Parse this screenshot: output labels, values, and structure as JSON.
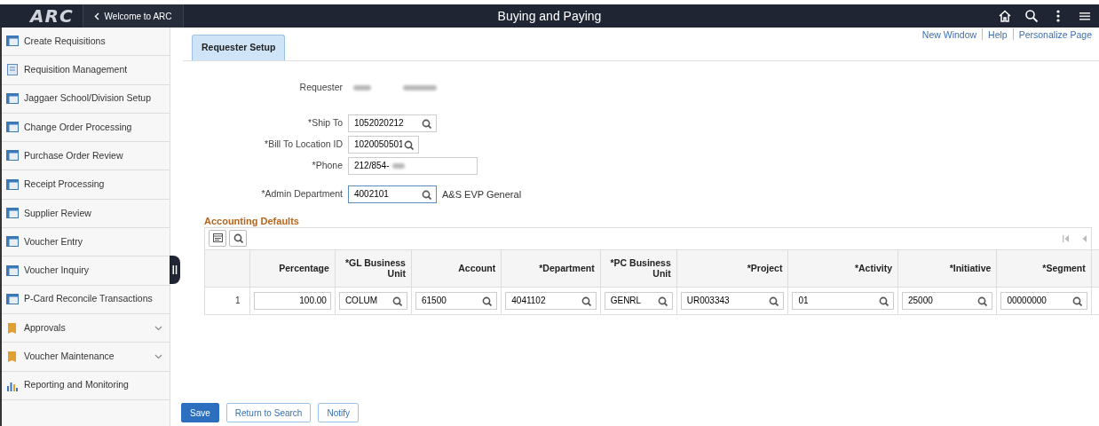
{
  "header": {
    "logo": "ARC",
    "back_button": "Welcome to ARC",
    "title": "Buying and Paying"
  },
  "sidebar": {
    "items": [
      {
        "label": "Create Requisitions",
        "kind": "page",
        "selected": false
      },
      {
        "label": "Requisition Management",
        "kind": "document",
        "selected": false
      },
      {
        "label": "Jaggaer School/Division Setup",
        "kind": "page",
        "selected": false
      },
      {
        "label": "Change Order Processing",
        "kind": "page",
        "selected": false
      },
      {
        "label": "Purchase Order Review",
        "kind": "page",
        "selected": false
      },
      {
        "label": "Receipt Processing",
        "kind": "page",
        "selected": false
      },
      {
        "label": "Supplier Review",
        "kind": "page",
        "selected": false
      },
      {
        "label": "Voucher Entry",
        "kind": "page",
        "selected": false
      },
      {
        "label": "Voucher Inquiry",
        "kind": "page",
        "selected": false
      },
      {
        "label": "P-Card Reconcile Transactions",
        "kind": "page",
        "selected": false
      },
      {
        "label": "Approvals",
        "kind": "folder",
        "selected": false
      },
      {
        "label": "Voucher Maintenance",
        "kind": "folder",
        "selected": false
      },
      {
        "label": "Reporting and Monitoring",
        "kind": "report",
        "selected": false
      }
    ]
  },
  "page_links": [
    "New Window",
    "Help",
    "Personalize Page"
  ],
  "tabs": [
    {
      "label": "Requester Setup",
      "selected": true
    }
  ],
  "form": {
    "requester_label": "Requester",
    "fields": [
      {
        "label": "*Ship To",
        "value": "1052020212",
        "kind": "lookup"
      },
      {
        "label": "*Bill To Location ID",
        "value": "1020050501",
        "kind": "lookup"
      },
      {
        "label": "*Phone",
        "value": "212/854-",
        "kind": "text"
      },
      {
        "label": "*Admin Department",
        "value": "4002101",
        "kind": "lookup",
        "description": "A&S EVP General"
      }
    ]
  },
  "accounting": {
    "title": "Accounting Defaults",
    "columns": [
      "Percentage",
      "*GL Business Unit",
      "Account",
      "*Department",
      "*PC Business Unit",
      "*Project",
      "*Activity",
      "*Initiative",
      "*Segment"
    ],
    "rows": [
      {
        "number": "1",
        "cells": [
          {
            "value": "100.00",
            "kind": "number"
          },
          {
            "value": "COLUM",
            "kind": "lookup"
          },
          {
            "value": "61500",
            "kind": "lookup"
          },
          {
            "value": "4041102",
            "kind": "lookup"
          },
          {
            "value": "GENRL",
            "kind": "lookup"
          },
          {
            "value": "UR003343",
            "kind": "lookup"
          },
          {
            "value": "01",
            "kind": "lookup"
          },
          {
            "value": "25000",
            "kind": "lookup"
          },
          {
            "value": "00000000",
            "kind": "lookup"
          }
        ]
      }
    ]
  },
  "buttons": [
    {
      "label": "Save",
      "kind": "primary"
    },
    {
      "label": "Return to Search",
      "kind": "secondary"
    },
    {
      "label": "Notify",
      "kind": "secondary"
    }
  ]
}
